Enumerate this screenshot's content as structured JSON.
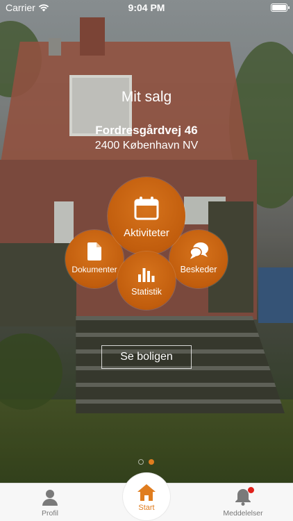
{
  "status_bar": {
    "carrier": "Carrier",
    "time": "9:04 PM"
  },
  "header": {
    "title": "Mit salg",
    "street": "Fordresgårdvej 46",
    "city": "2400 København NV"
  },
  "menu": {
    "aktiviteter": "Aktiviteter",
    "dokumenter": "Dokumenter",
    "beskeder": "Beskeder",
    "statistik": "Statistik"
  },
  "see_button": "Se boligen",
  "page_indicator": {
    "pages": 2,
    "current": 2
  },
  "tabbar": {
    "profil": "Profil",
    "start": "Start",
    "meddelelser": "Meddelelser"
  },
  "colors": {
    "accent": "#e07d1f",
    "badge": "#e0201a"
  }
}
